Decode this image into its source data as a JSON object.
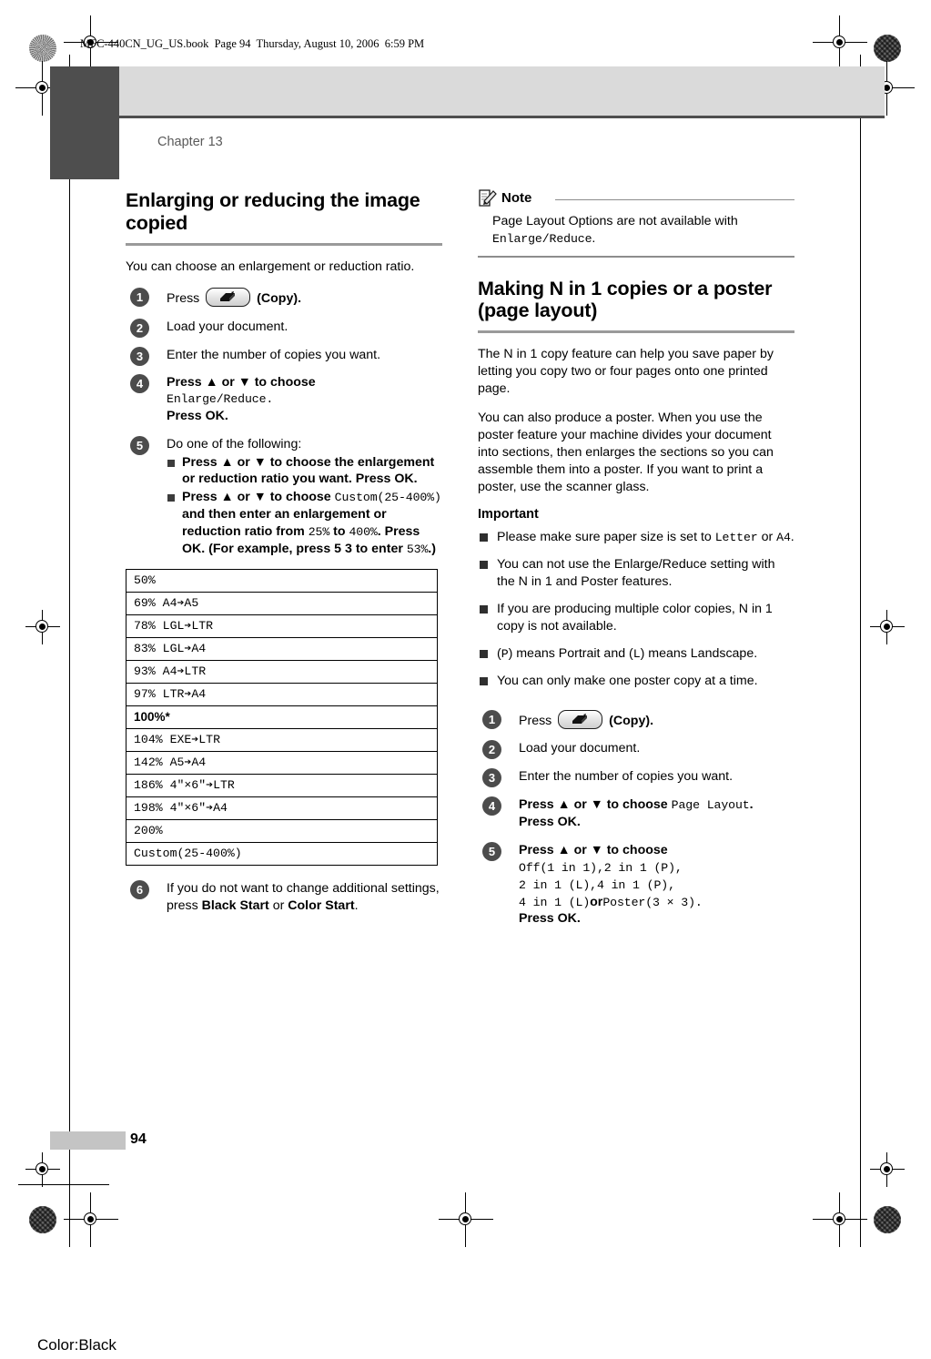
{
  "print_marks": {
    "book_info": "MFC-440CN_UG_US.book  Page 94  Thursday, August 10, 2006  6:59 PM",
    "color_mark": "Color:Black"
  },
  "page": {
    "chapter_label": "Chapter 13",
    "page_number": "94"
  },
  "left_column": {
    "section_title": "Enlarging or reducing the image copied",
    "intro": "You can choose an enlargement or reduction ratio.",
    "steps": [
      {
        "num": "1",
        "pre": "Press",
        "icon": "copy-button-icon",
        "post": "(Copy)."
      },
      {
        "num": "2",
        "text": "Load your document."
      },
      {
        "num": "3",
        "text": "Enter the number of copies you want."
      },
      {
        "num": "4",
        "line1": "Press ▲ or ▼ to choose",
        "mono1": "Enlarge/Reduce.",
        "line2_pre": "Press ",
        "line2_bold": "OK",
        "line2_post": "."
      },
      {
        "num": "5",
        "lead": "Do one of the following:",
        "sub1_a": "Press ▲ or ▼ to choose the enlargement or reduction ratio you want. Press ",
        "sub1_bold": "OK",
        "sub1_b": ".",
        "sub2_a": "Press ▲ or ▼ to choose ",
        "sub2_mono1": "Custom(25-400%)",
        "sub2_b": " and then enter an enlargement or reduction ratio from ",
        "sub2_mono2": "25%",
        "sub2_c": " to ",
        "sub2_mono3": "400%",
        "sub2_d": ". Press ",
        "sub2_bold": "OK",
        "sub2_e": ". (For example, press ",
        "sub2_keys": "5 3",
        "sub2_f": " to enter ",
        "sub2_mono4": "53%",
        "sub2_g": ".)"
      },
      {
        "num": "6",
        "text_a": "If you do not want to change additional settings, press ",
        "bold_a": "Black Start",
        "text_b": " or ",
        "bold_b": "Color Start",
        "text_c": "."
      }
    ],
    "ratio_table": {
      "rows": [
        {
          "value": "50%",
          "highlighted": false
        },
        {
          "value": "69% A4➔A5",
          "highlighted": false
        },
        {
          "value": "78% LGL➔LTR",
          "highlighted": false
        },
        {
          "value": "83% LGL➔A4",
          "highlighted": false
        },
        {
          "value": "93% A4➔LTR",
          "highlighted": false
        },
        {
          "value": "97% LTR➔A4",
          "highlighted": false
        },
        {
          "value": "100%*",
          "highlighted": true
        },
        {
          "value": "104% EXE➔LTR",
          "highlighted": false
        },
        {
          "value": "142% A5➔A4",
          "highlighted": false
        },
        {
          "value": "186% 4\"×6\"➔LTR",
          "highlighted": false
        },
        {
          "value": "198% 4\"×6\"➔A4",
          "highlighted": false
        },
        {
          "value": "200%",
          "highlighted": false
        },
        {
          "value": "Custom(25-400%)",
          "highlighted": false
        }
      ]
    }
  },
  "right_column": {
    "note": {
      "icon": "note-pencil-icon",
      "title": "Note",
      "body_a": "Page Layout Options are not available with ",
      "body_mono": "Enlarge/Reduce",
      "body_b": "."
    },
    "section_title": "Making N in 1 copies or a poster (page layout)",
    "para1": "The N in 1 copy feature can help you save paper by letting you copy two or four pages onto one printed page.",
    "para2": "You can also produce a poster. When you use the poster feature your machine divides your document into sections, then enlarges the sections so you can assemble them into a poster. If you want to print a poster, use the scanner glass.",
    "important_heading": "Important",
    "important_bullets": [
      {
        "a": "Please make sure paper size is set to ",
        "mono1": "Letter",
        "b": " or ",
        "mono2": "A4",
        "c": "."
      },
      {
        "a": "You can not use the Enlarge/Reduce setting with the N in 1 and Poster features."
      },
      {
        "a": "If you are producing multiple color copies, N in 1 copy is not available."
      },
      {
        "a": "(",
        "mono1": "P",
        "b": ") means Portrait and (",
        "mono2": "L",
        "c": ") means Landscape."
      },
      {
        "a": "You can only make one poster copy at a time."
      }
    ],
    "steps": [
      {
        "num": "1",
        "pre": "Press",
        "icon": "copy-button-icon",
        "post": "(Copy)."
      },
      {
        "num": "2",
        "text": "Load your document."
      },
      {
        "num": "3",
        "text": "Enter the number of copies you want."
      },
      {
        "num": "4",
        "line1_a": "Press ▲ or ▼ to choose ",
        "line1_mono": "Page Layout",
        "line1_b": ".",
        "line2_pre": "Press ",
        "line2_bold": "OK",
        "line2_post": "."
      },
      {
        "num": "5",
        "line1": "Press ▲ or ▼ to choose",
        "mono_l1": "Off(1 in 1),",
        "mono_l1b": "2 in 1 (P),",
        "mono_l2": "2 in 1 (L),",
        "mono_l2b": "4 in 1 (P),",
        "mono_l3": "4 in 1 (L)",
        "or_text": "or",
        "mono_l3b": "Poster(3 × 3).",
        "line2_pre": "Press ",
        "line2_bold": "OK",
        "line2_post": "."
      }
    ]
  },
  "colors": {
    "chapter_tab": "#4e4e4e",
    "head_band": "#dadada",
    "rule": "#9a9a9a",
    "step_circle": "#4c4c4c"
  }
}
